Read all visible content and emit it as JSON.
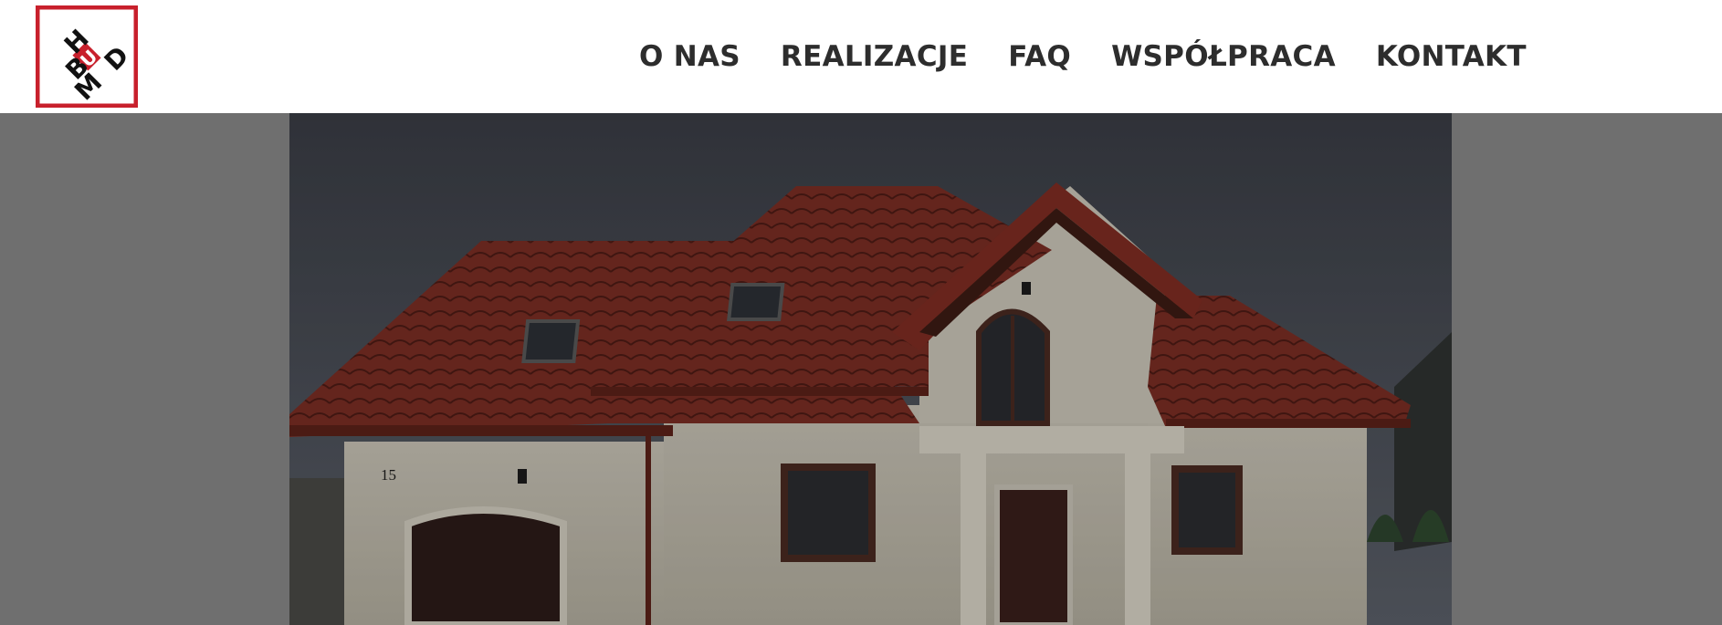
{
  "brand": {
    "logo_text": "MBUDH",
    "logo_letters": [
      "B",
      "U",
      "H",
      "M",
      "D"
    ],
    "colors": {
      "red": "#c8202c",
      "black": "#111111"
    }
  },
  "nav": {
    "items": [
      {
        "label": "O NAS"
      },
      {
        "label": "REALIZACJE"
      },
      {
        "label": "FAQ"
      },
      {
        "label": "WSPÓŁPRACA"
      },
      {
        "label": "KONTAKT"
      }
    ]
  },
  "hero": {
    "house_number": "15",
    "image_icon": "house-photo"
  }
}
